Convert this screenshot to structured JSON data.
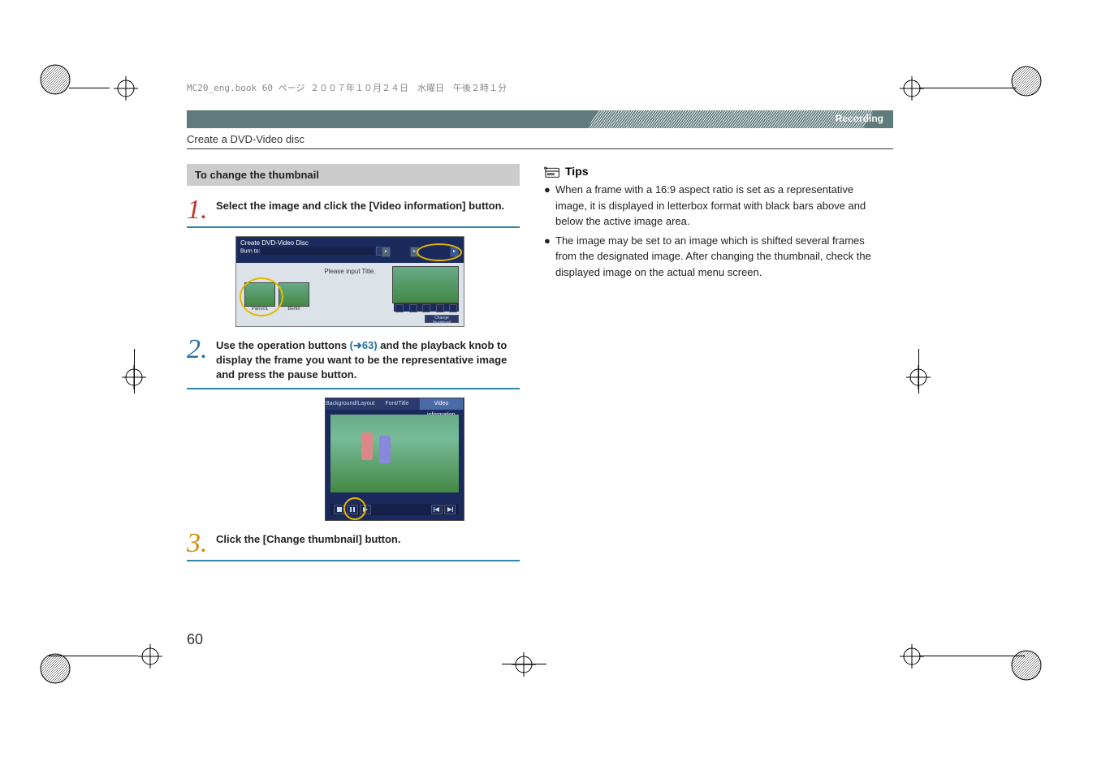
{
  "meta": {
    "file_info": "MC20_eng.book  60 ページ  ２００７年１０月２４日　水曜日　午後２時１分"
  },
  "header": {
    "section_label": "Recording",
    "subsection": "Create a DVD-Video disc"
  },
  "heading_box": "To change the thumbnail",
  "steps": {
    "s1": {
      "num": "1.",
      "text": "Select the image and click the [Video information] button."
    },
    "s2": {
      "num": "2.",
      "pre": "Use the operation buttons ",
      "ref": "(➜63)",
      "post": " and the playback knob to display the frame you want to be the representative image and press the pause button."
    },
    "s3": {
      "num": "3.",
      "text": "Click the [Change thumbnail] button."
    }
  },
  "ill1": {
    "title": "Create DVD-Video Disc",
    "burn_loc_label": "Burn to:",
    "tile_msg": "Please input Title.",
    "thumb1": "Paris01",
    "thumb2": "Berlin",
    "change_btn": "Change thumbnail"
  },
  "ill2": {
    "tabs": {
      "t1": "Background/Layout",
      "t2": "Font/Title",
      "t3": "Video information"
    }
  },
  "tips": {
    "label": "Tips",
    "t1": "When a frame with a 16:9 aspect ratio is set as a representative image, it is displayed in letterbox format with black bars above and below the active image area.",
    "t2": "The image may be set to an image which is shifted several frames from the designated image. After changing the thumbnail, check the displayed image on the actual menu screen."
  },
  "page_number": "60"
}
